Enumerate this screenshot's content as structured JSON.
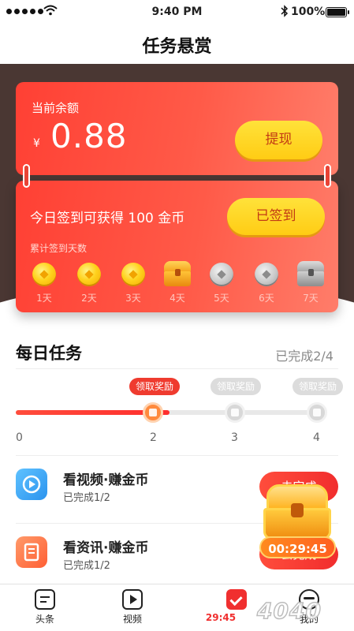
{
  "status_bar": {
    "time": "9:40 PM",
    "battery": "100%"
  },
  "header": {
    "title": "任务悬赏"
  },
  "balance_card": {
    "label": "当前余额",
    "currency": "¥",
    "amount": "0.88",
    "withdraw_label": "提现"
  },
  "checkin_card": {
    "text": "今日签到可获得 100 金币",
    "button_label": "已签到",
    "streak_label": "累计签到天数",
    "days": [
      {
        "label": "1天",
        "reward": "gold-coin"
      },
      {
        "label": "2天",
        "reward": "gold-coin"
      },
      {
        "label": "3天",
        "reward": "gold-coin"
      },
      {
        "label": "4天",
        "reward": "gold-chest"
      },
      {
        "label": "5天",
        "reward": "silver-coin"
      },
      {
        "label": "6天",
        "reward": "silver-coin"
      },
      {
        "label": "7天",
        "reward": "silver-chest"
      }
    ]
  },
  "daily_tasks": {
    "title": "每日任务",
    "progress_text": "已完成2/4",
    "progress_fraction": 0.5,
    "milestones": [
      {
        "value": "0"
      },
      {
        "value": "2",
        "reward_label": "领取奖励",
        "state": "active"
      },
      {
        "value": "3",
        "reward_label": "领取奖励",
        "state": "inactive"
      },
      {
        "value": "4",
        "reward_label": "领取奖励",
        "state": "inactive"
      }
    ],
    "items": [
      {
        "title": "看视频·赚金币",
        "status": "已完成1/2",
        "button_label": "去完成",
        "icon": "video-icon"
      },
      {
        "title": "看资讯·赚金币",
        "status": "已完成1/2",
        "button_label": "去完成",
        "icon": "article-icon"
      }
    ]
  },
  "floating_reward": {
    "timer": "00:29:45"
  },
  "tab_bar": {
    "tabs": [
      {
        "label": "头条",
        "icon": "news-icon"
      },
      {
        "label": "视频",
        "icon": "video-play-icon"
      },
      {
        "label": "29:45",
        "icon": "task-check-icon",
        "active": true
      },
      {
        "label": "我的",
        "icon": "profile-icon"
      }
    ]
  },
  "watermark": "4040",
  "colors": {
    "accent": "#f02f2f",
    "hero_bg": "#4a3733",
    "button_yellow": "#ffd21d"
  }
}
